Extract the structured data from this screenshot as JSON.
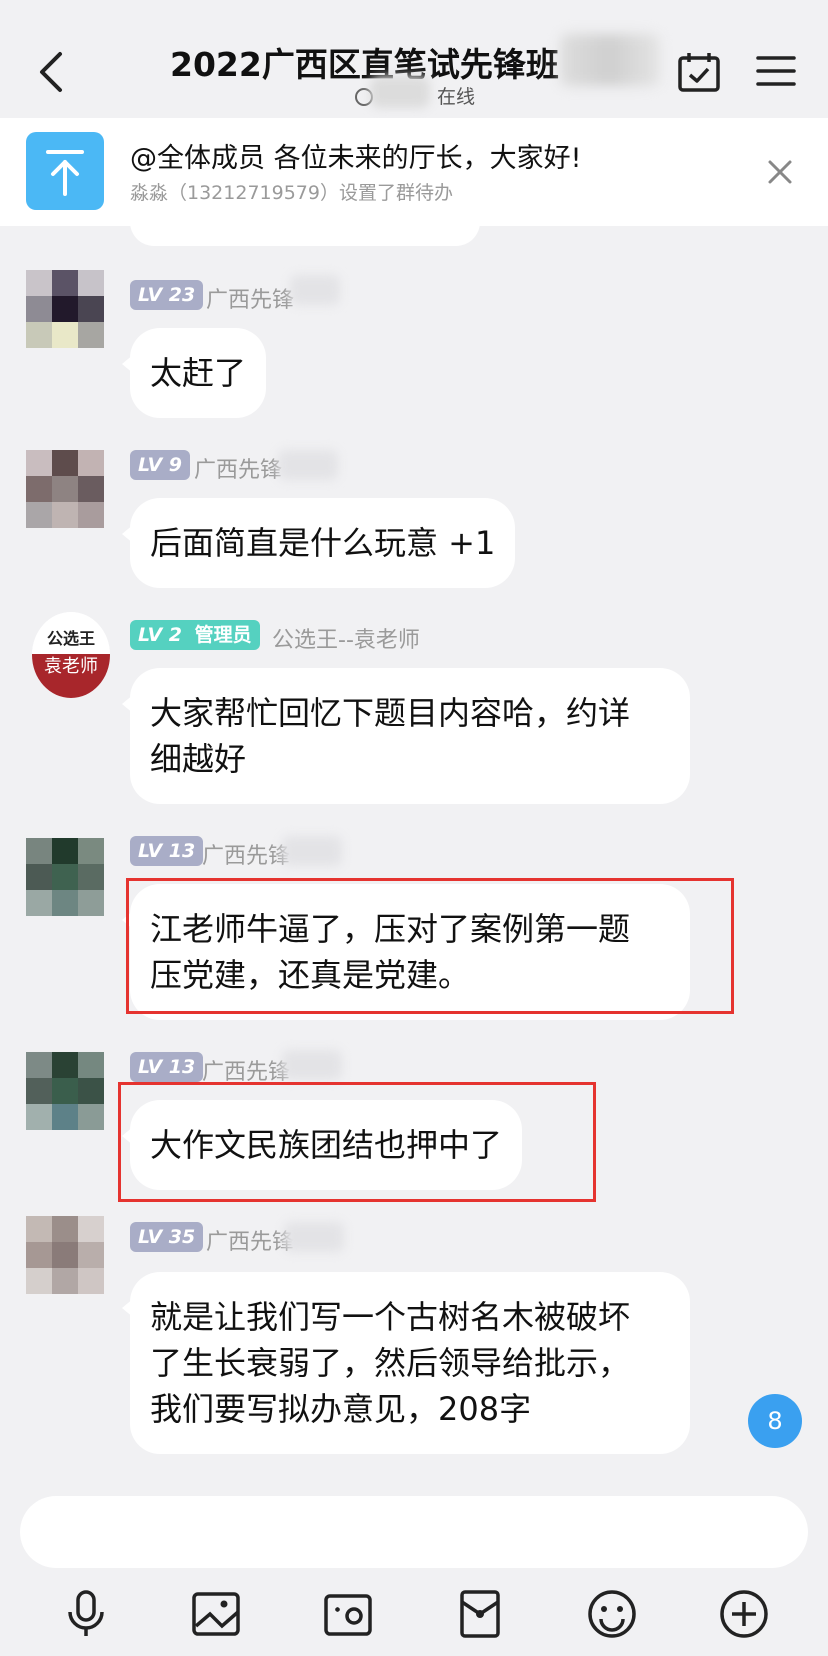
{
  "header": {
    "title": "2022广西区直笔试先锋班",
    "subtitle": "在线"
  },
  "todo": {
    "title": "@全体成员 各位未来的厅长，大家好!",
    "subtitle": "淼淼（13212719579）设置了群待办"
  },
  "messages": [
    {
      "level": "LV 23",
      "sender": "广西先锋",
      "text": "太赶了"
    },
    {
      "level": "LV 9",
      "sender": "广西先锋",
      "text": "后面简直是什么玩意 +1"
    },
    {
      "level": "LV 2",
      "role": "管理员",
      "sender": "公选王--袁老师",
      "avatar_text_top": "公选王",
      "avatar_text_bottom": "袁老师",
      "text_line1": "大家帮忙回忆下题目内容哈，约详",
      "text_line2": "细越好"
    },
    {
      "level": "LV 13",
      "sender": "广西先锋",
      "text_line1": "江老师牛逼了，压对了案例第一题",
      "text_line2": "压党建，还真是党建。",
      "highlighted": true
    },
    {
      "level": "LV 13",
      "sender": "广西先锋",
      "text": "大作文民族团结也押中了",
      "highlighted": true
    },
    {
      "level": "LV 35",
      "sender": "广西先锋",
      "text_line1": "就是让我们写一个古树名木被破坏",
      "text_line2": "了生长衰弱了，然后领导给批示，",
      "text_line3": "我们要写拟办意见，208字"
    }
  ],
  "unread_count": "8",
  "toolbar": {
    "icons": [
      "microphone-icon",
      "image-icon",
      "camera-icon",
      "red-packet-icon",
      "emoji-icon",
      "plus-icon"
    ]
  },
  "colors": {
    "background": "#f1f1f3",
    "accent": "#3aa0f0",
    "todo_icon": "#4bb8f5",
    "highlight": "#e5332f",
    "level_badge": "#a9adc7",
    "admin_badge": "#55d1c0"
  }
}
